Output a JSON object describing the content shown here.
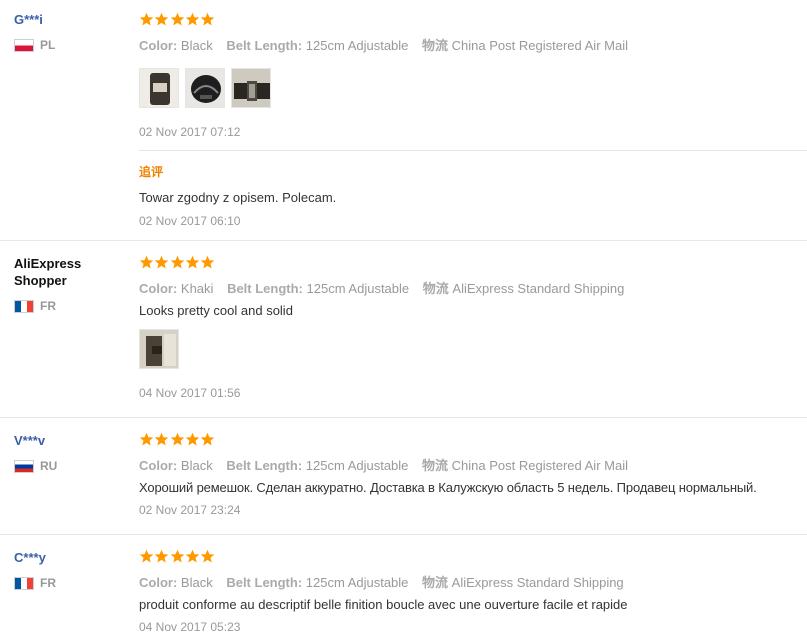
{
  "labels": {
    "color": "Color:",
    "belt_length": "Belt Length:",
    "shipping": "物流",
    "followup": "追评"
  },
  "colors": {
    "star": "#ff9900",
    "username_link": "#3a5ea8",
    "followup": "#f08200"
  },
  "reviews": [
    {
      "user": "G***i",
      "country": "PL",
      "flag": "poland-flag",
      "rating": 5,
      "color": "Black",
      "belt_length": "125cm Adjustable",
      "shipping": "China Post Registered Air Mail",
      "text": "",
      "photos": 3,
      "date": "02 Nov 2017 07:12",
      "followup": {
        "text": "Towar zgodny z opisem. Polecam.",
        "date": "02 Nov 2017 06:10"
      }
    },
    {
      "user": "AliExpress Shopper",
      "country": "FR",
      "flag": "france-flag",
      "rating": 5,
      "color": "Khaki",
      "belt_length": "125cm Adjustable",
      "shipping": "AliExpress Standard Shipping",
      "text": "Looks pretty cool and solid",
      "photos": 1,
      "date": "04 Nov 2017 01:56"
    },
    {
      "user": "V***v",
      "country": "RU",
      "flag": "russia-flag",
      "rating": 5,
      "color": "Black",
      "belt_length": "125cm Adjustable",
      "shipping": "China Post Registered Air Mail",
      "text": "Хороший ремешок. Сделан аккуратно. Доставка в Калужскую область 5 недель. Продавец нормальный.",
      "photos": 0,
      "date": "02 Nov 2017 23:24"
    },
    {
      "user": "C***y",
      "country": "FR",
      "flag": "france-flag",
      "rating": 5,
      "color": "Black",
      "belt_length": "125cm Adjustable",
      "shipping": "AliExpress Standard Shipping",
      "text": "produit conforme au descriptif belle finition boucle avec une ouverture facile et rapide",
      "photos": 0,
      "date": "04 Nov 2017 05:23"
    }
  ]
}
